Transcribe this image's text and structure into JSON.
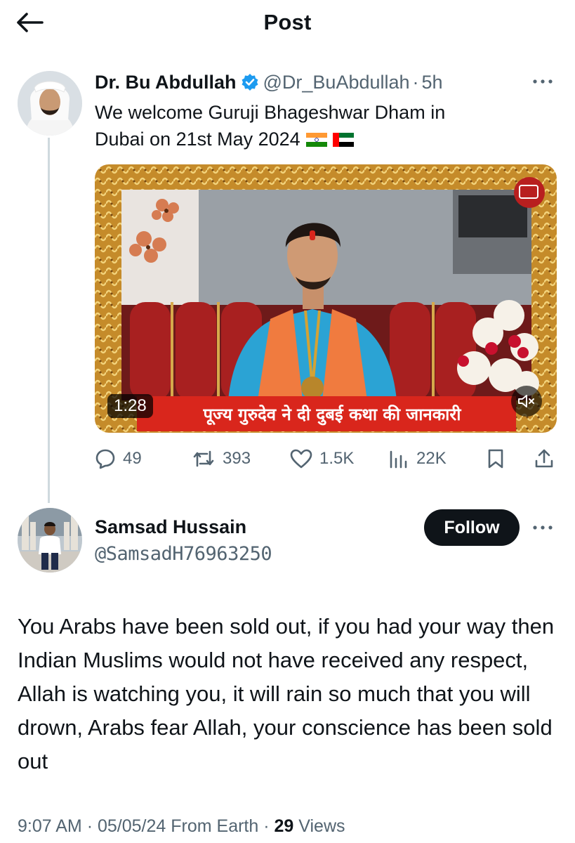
{
  "header": {
    "title": "Post"
  },
  "original_post": {
    "name": "Dr. Bu Abdullah",
    "handle": "@Dr_BuAbdullah",
    "separator": "·",
    "time": "5h",
    "text_line1": "We welcome Guruji Bhageshwar Dham in",
    "text_line2": "Dubai on 21st May 2024",
    "flags": [
      "india-flag-icon",
      "uae-flag-icon"
    ],
    "video": {
      "duration": "1:28",
      "caption": "पूज्य गुरुदेव ने दी दुबई कथा की जानकारी"
    },
    "stats": {
      "replies": "49",
      "reposts": "393",
      "likes": "1.5K",
      "views": "22K"
    }
  },
  "reply": {
    "name": "Samsad Hussain",
    "handle": "@SamsadH76963250",
    "follow_label": "Follow",
    "text": "You Arabs have been sold out, if you had your way then Indian Muslims would not have received any respect, Allah is watching you, it will rain so much that you will drown, Arabs fear Allah, your conscience has been sold out",
    "meta": {
      "time": "9:07 AM",
      "separator": "·",
      "date": "05/05/24",
      "source": "From Earth",
      "views_count": "29",
      "views_label": "Views"
    }
  },
  "colors": {
    "text_primary": "#0f1419",
    "text_secondary": "#536471",
    "verified_blue": "#1d9bf0",
    "thread_line": "#cfd9de",
    "follow_bg": "#0f1419"
  }
}
